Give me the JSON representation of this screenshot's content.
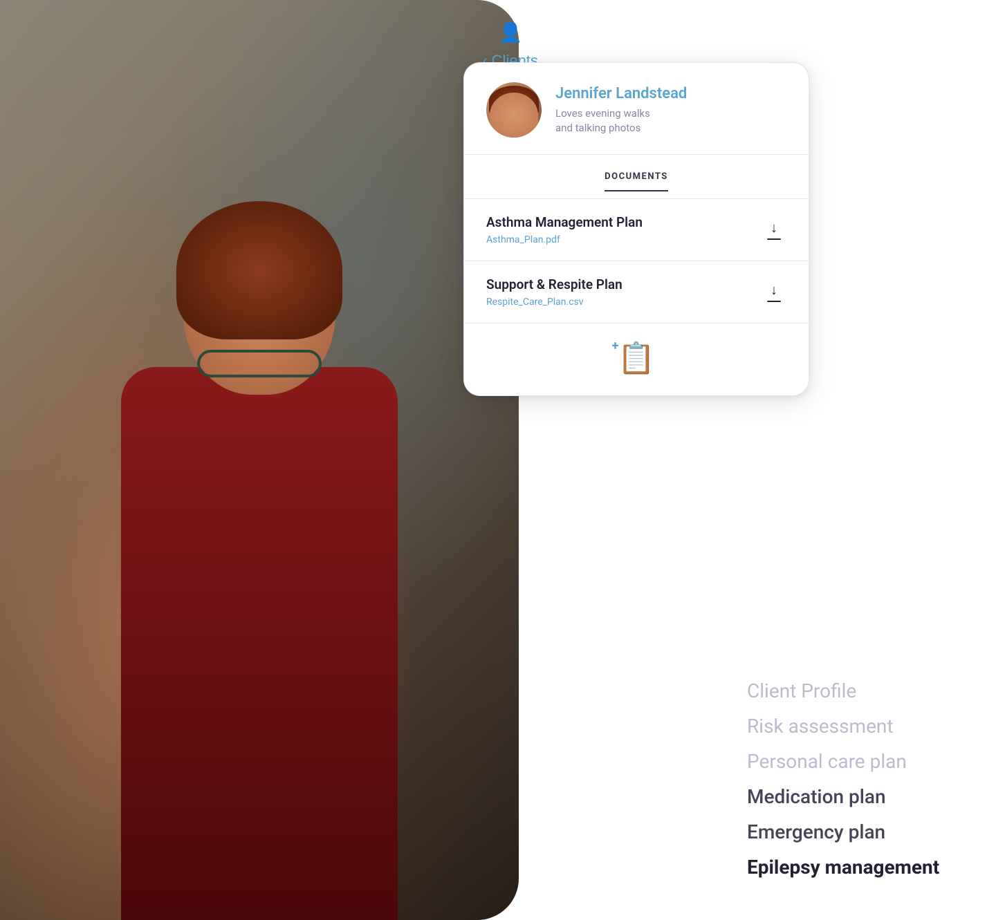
{
  "nav": {
    "back_label": "Clients",
    "back_chevron": "‹",
    "user_icon": "👤"
  },
  "card": {
    "client": {
      "name": "Jennifer Landstead",
      "bio": "Loves evening walks\nand talking photos"
    },
    "tab": {
      "label": "DOCUMENTS"
    },
    "documents": [
      {
        "title": "Asthma Management Plan",
        "filename": "Asthma_Plan.pdf"
      },
      {
        "title": "Support & Respite Plan",
        "filename": "Respite_Care_Plan.csv"
      }
    ],
    "add_document_label": "Add document"
  },
  "sidebar": {
    "items": [
      {
        "label": "Client Profile",
        "state": "faded"
      },
      {
        "label": "Risk assessment",
        "state": "faded"
      },
      {
        "label": "Personal care plan",
        "state": "faded"
      },
      {
        "label": "Medication plan",
        "state": "semi"
      },
      {
        "label": "Emergency plan",
        "state": "semi-active"
      },
      {
        "label": "Epilepsy management",
        "state": "active"
      }
    ]
  }
}
